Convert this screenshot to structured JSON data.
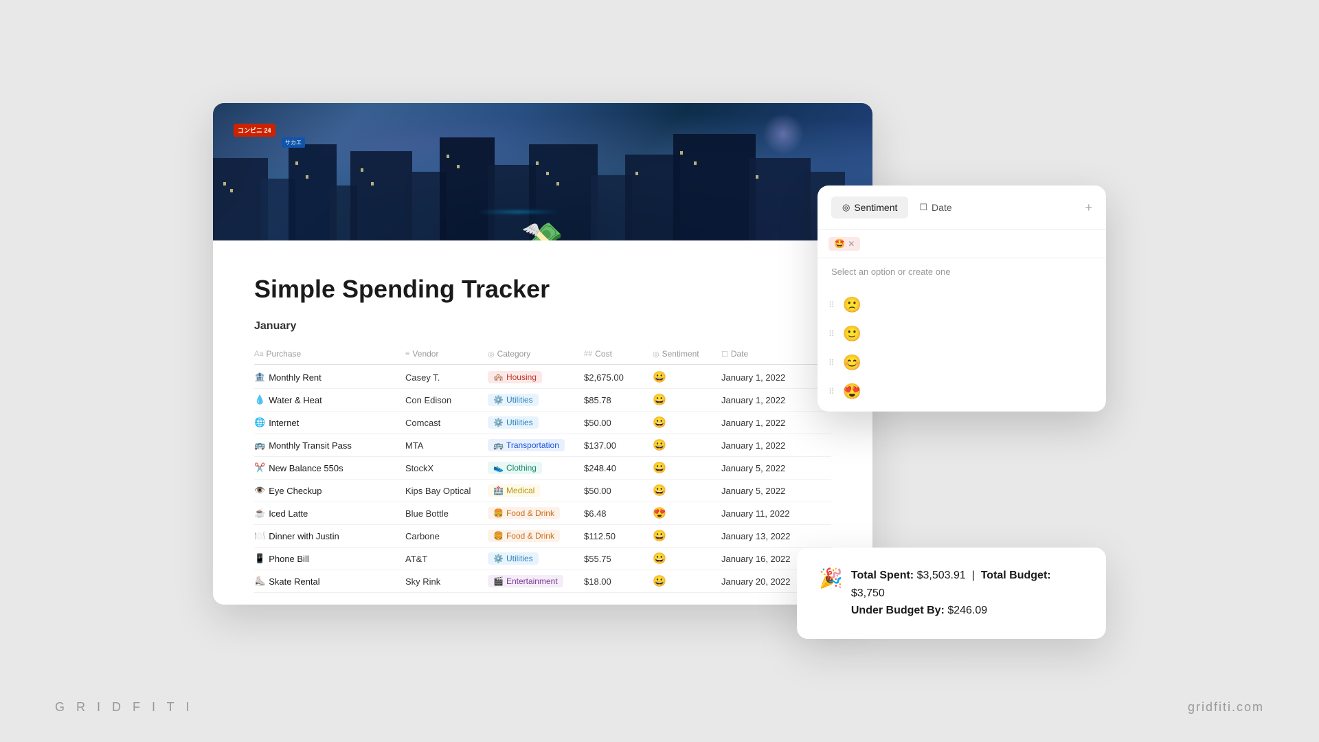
{
  "branding": {
    "left": "G R I D F I T I",
    "right": "gridfiti.com"
  },
  "page": {
    "title": "Simple Spending Tracker",
    "section": "January",
    "money_icon": "💸"
  },
  "table": {
    "headers": [
      {
        "icon": "Aa",
        "label": "Purchase"
      },
      {
        "icon": "≡",
        "label": "Vendor"
      },
      {
        "icon": "◎",
        "label": "Category"
      },
      {
        "icon": "##",
        "label": "Cost"
      },
      {
        "icon": "◎",
        "label": "Sentiment"
      },
      {
        "icon": "☐",
        "label": "Date"
      },
      {
        "icon": "+",
        "label": ""
      }
    ],
    "rows": [
      {
        "purchase_icon": "🏦",
        "purchase": "Monthly Rent",
        "vendor": "Casey T.",
        "category": "Housing",
        "category_class": "cat-housing",
        "category_icon": "🏘️",
        "cost": "$2,675.00",
        "sentiment": "😀",
        "date": "January 1, 2022"
      },
      {
        "purchase_icon": "💧",
        "purchase": "Water & Heat",
        "vendor": "Con Edison",
        "category": "Utilities",
        "category_class": "cat-utilities",
        "category_icon": "⚙️",
        "cost": "$85.78",
        "sentiment": "😀",
        "date": "January 1, 2022"
      },
      {
        "purchase_icon": "🌐",
        "purchase": "Internet",
        "vendor": "Comcast",
        "category": "Utilities",
        "category_class": "cat-utilities",
        "category_icon": "⚙️",
        "cost": "$50.00",
        "sentiment": "😀",
        "date": "January 1, 2022"
      },
      {
        "purchase_icon": "🚌",
        "purchase": "Monthly Transit Pass",
        "vendor": "MTA",
        "category": "Transportation",
        "category_class": "cat-transportation",
        "category_icon": "🚌",
        "cost": "$137.00",
        "sentiment": "😀",
        "date": "January 1, 2022"
      },
      {
        "purchase_icon": "✂️",
        "purchase": "New Balance 550s",
        "vendor": "StockX",
        "category": "Clothing",
        "category_class": "cat-clothing",
        "category_icon": "👟",
        "cost": "$248.40",
        "sentiment": "😀",
        "date": "January 5, 2022"
      },
      {
        "purchase_icon": "👁️",
        "purchase": "Eye Checkup",
        "vendor": "Kips Bay Optical",
        "category": "Medical",
        "category_class": "cat-medical",
        "category_icon": "🏥",
        "cost": "$50.00",
        "sentiment": "😀",
        "date": "January 5, 2022"
      },
      {
        "purchase_icon": "☕",
        "purchase": "Iced Latte",
        "vendor": "Blue Bottle",
        "category": "Food & Drink",
        "category_class": "cat-food",
        "category_icon": "🍔",
        "cost": "$6.48",
        "sentiment": "😍",
        "date": "January 11, 2022"
      },
      {
        "purchase_icon": "🍽️",
        "purchase": "Dinner with Justin",
        "vendor": "Carbone",
        "category": "Food & Drink",
        "category_class": "cat-food",
        "category_icon": "🍔",
        "cost": "$112.50",
        "sentiment": "😀",
        "date": "January 13, 2022"
      },
      {
        "purchase_icon": "📱",
        "purchase": "Phone Bill",
        "vendor": "AT&T",
        "category": "Utilities",
        "category_class": "cat-utilities",
        "category_icon": "⚙️",
        "cost": "$55.75",
        "sentiment": "😀",
        "date": "January 16, 2022"
      },
      {
        "purchase_icon": "⛸️",
        "purchase": "Skate Rental",
        "vendor": "Sky Rink",
        "category": "Entertainment",
        "category_class": "cat-entertainment",
        "category_icon": "🎬",
        "cost": "$18.00",
        "sentiment": "😀",
        "date": "January 20, 2022"
      }
    ]
  },
  "dropdown": {
    "tab_sentiment": "Sentiment",
    "tab_date": "Date",
    "selected_tag_emoji": "🤩",
    "hint": "Select an option or create one",
    "options": [
      {
        "emoji": "🙁"
      },
      {
        "emoji": "🙂"
      },
      {
        "emoji": "😊"
      },
      {
        "emoji": "😍"
      }
    ]
  },
  "budget": {
    "icon": "🎉",
    "total_spent_label": "Total Spent:",
    "total_spent_value": "$3,503.91",
    "separator": "|",
    "total_budget_label": "Total Budget:",
    "total_budget_value": "$3,750",
    "under_budget_label": "Under Budget By:",
    "under_budget_value": "$246.09"
  }
}
